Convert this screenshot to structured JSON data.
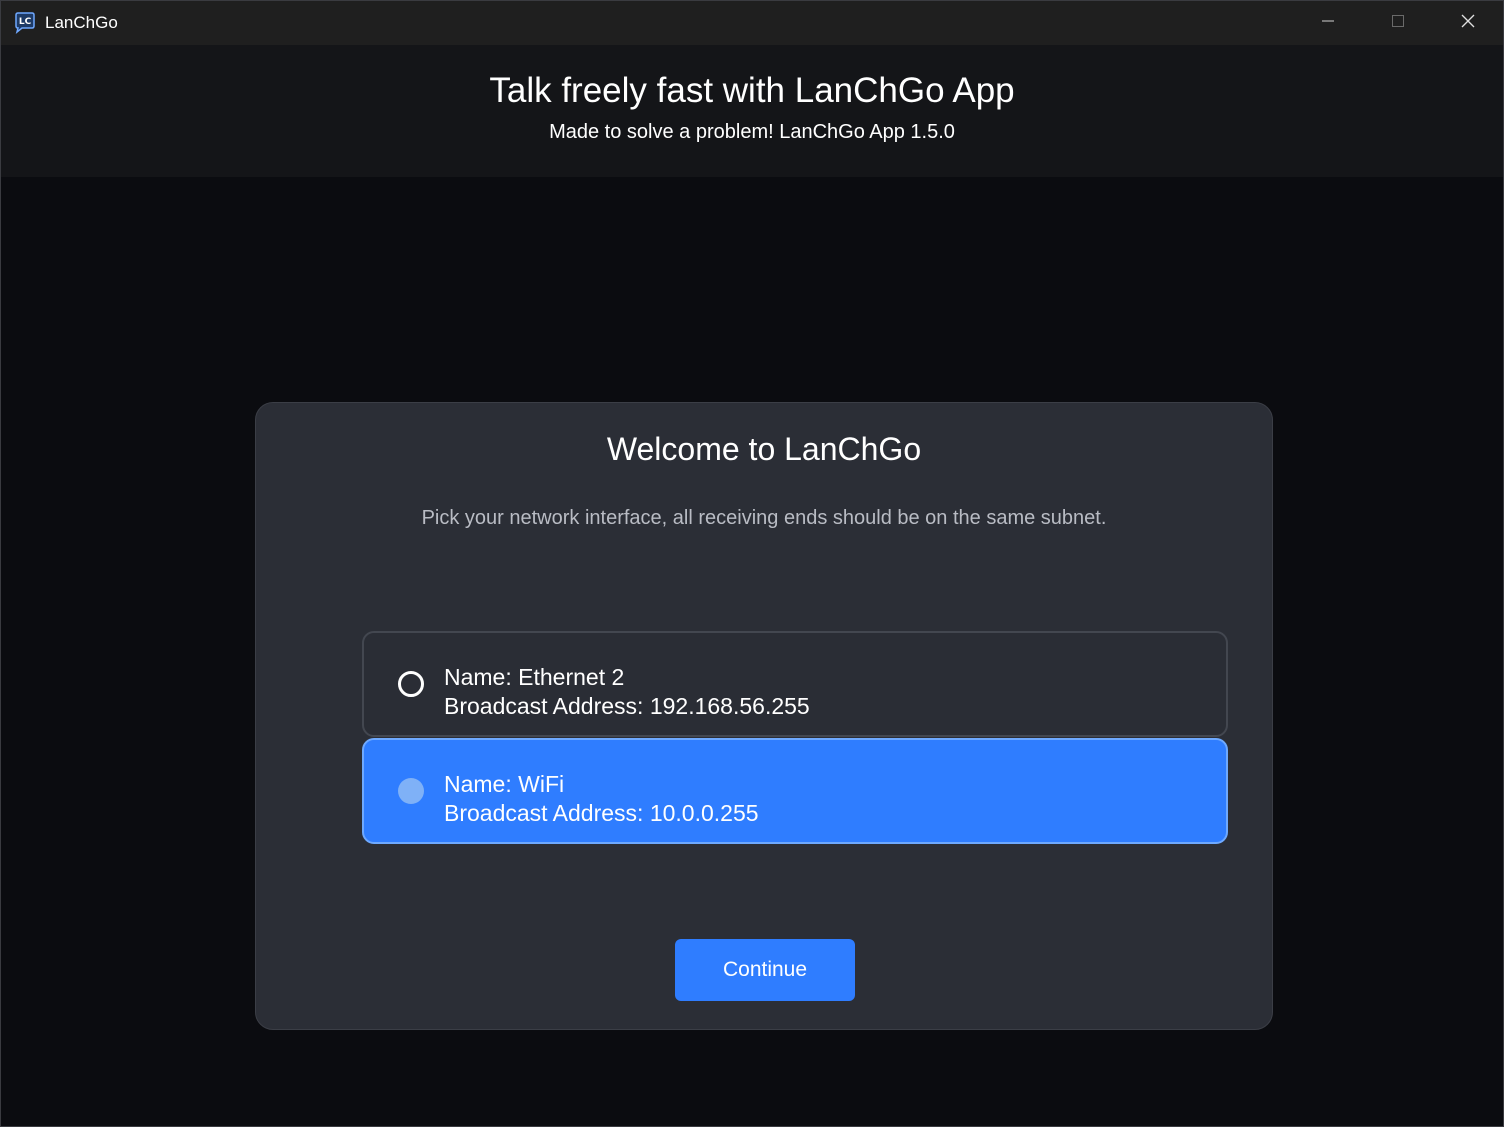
{
  "window": {
    "title": "LanChGo",
    "controls": [
      "minimize",
      "maximize",
      "close"
    ]
  },
  "header": {
    "title": "Talk freely fast with LanChGo App",
    "subtitle": "Made to solve a problem! LanChGo App 1.5.0"
  },
  "card": {
    "title": "Welcome to LanChGo",
    "description": "Pick your network interface, all receiving ends should be on the same subnet.",
    "options": [
      {
        "name": "Name: Ethernet 2",
        "broadcast": "Broadcast Address: 192.168.56.255",
        "selected": false
      },
      {
        "name": "Name: WiFi",
        "broadcast": "Broadcast Address: 10.0.0.255",
        "selected": true
      }
    ],
    "continue_label": "Continue"
  },
  "colors": {
    "accent": "#2f7dff",
    "background": "#0b0c10",
    "card": "#2b2e36",
    "header": "#141518"
  },
  "icons": {
    "app": "lanchgo-chat-icon",
    "minimize": "minimize-icon",
    "maximize": "maximize-icon",
    "close": "close-icon"
  }
}
